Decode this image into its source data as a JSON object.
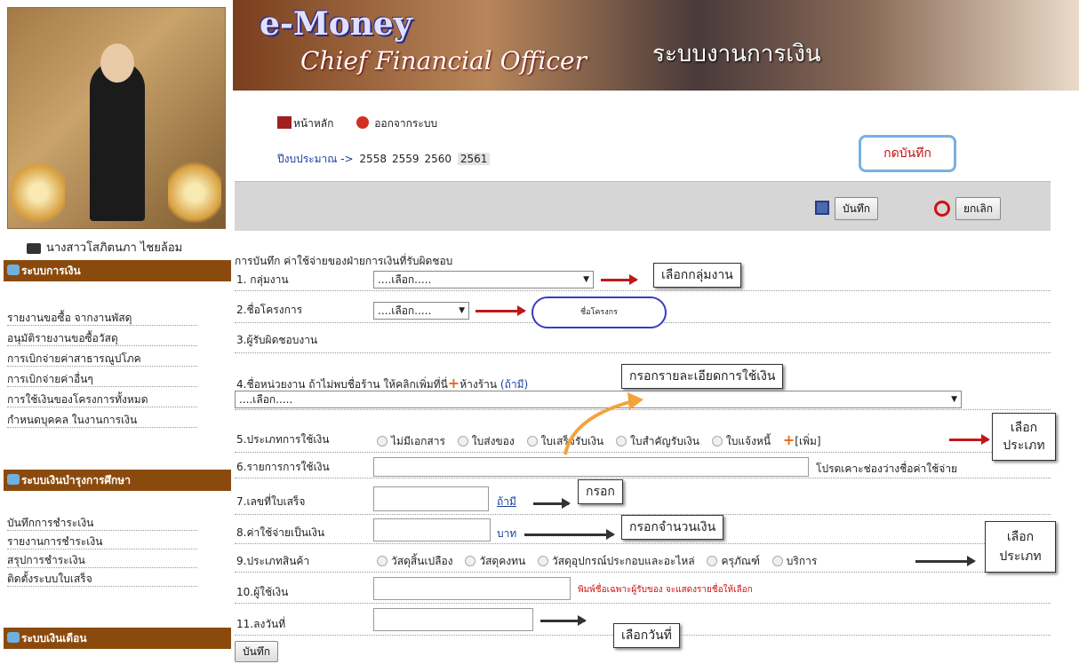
{
  "sidebar": {
    "user_name": "นางสาวโสภิตนภา ไชยล้อม",
    "sections": [
      {
        "title": "ระบบการเงิน",
        "items": [
          "รายงานขอซื้อ จากงานพัสดุ",
          "อนุมัติรายงานขอซื้อวัสดุ",
          "การเบิกจ่ายค่าสาธารณูปโภค",
          "การเบิกจ่ายค่าอื่นๆ",
          "การใช้เงินของโครงการทั้งหมด",
          "กำหนดบุคคล ในงานการเงิน"
        ]
      },
      {
        "title": "ระบบเงินบำรุงการศึกษา",
        "items": [
          "บันทึกการชำระเงิน",
          "รายงานการชำระเงิน",
          "สรุปการชำระเงิน",
          "ติดตั้งระบบใบเสร็จ"
        ]
      },
      {
        "title": "ระบบเงินเดือน",
        "items": []
      }
    ]
  },
  "banner": {
    "logo_line1": "e-Money",
    "logo_line2": "Chief Financial Officer",
    "title": "ระบบงานการเงิน"
  },
  "nav": {
    "home": "หน้าหลัก",
    "logout": "ออกจากระบบ"
  },
  "years": {
    "label": "ปีงบประมาณ ->",
    "list": [
      "2558",
      "2559",
      "2560"
    ],
    "current": "2561"
  },
  "toolbar": {
    "save": "บันทึก",
    "cancel": "ยกเลิก",
    "save_hint": "กดบันทึก"
  },
  "form": {
    "title": "การบันทึก ค่าใช้จ่ายของฝ่ายการเงินที่รับผิดชอบ",
    "select_placeholder": "....เลือก.....",
    "rows": {
      "group": "1. กลุ่มงาน",
      "project": "2.ชื่อโครงการ",
      "owner": "3.ผู้รับผิดชอบงาน",
      "vendor": "4.ชื่อหน่วยงาน ถ้าไม่พบชื่อร้าน ให้คลิกเพิ่มที่นี่",
      "vendor_link": "ห้างร้าน",
      "vendor_opt": "(ถ้ามี)",
      "paytype": "5.ประเภทการใช้เงิน",
      "desc": "6.รายการการใช้เงิน",
      "receipt": "7.เลขที่ใบเสร็จ",
      "amount": "8.ค่าใช้จ่ายเป็นเงิน",
      "goods": "9.ประเภทสินค้า",
      "payer": "10.ผู้ใช้เงิน",
      "date": "11.ลงวันที่"
    },
    "paytype_options": [
      "ไม่มีเอกสาร",
      "ใบส่งของ",
      "ใบเสร็จรับเงิน",
      "ใบสำคัญรับเงิน",
      "ใบแจ้งหนี้"
    ],
    "add_label": "[เพิ่ม]",
    "desc_note": "โปรดเคาะช่องว่างชื่อค่าใช้จ่าย",
    "receipt_opt": "ถ้ามี",
    "amount_unit": "บาท",
    "goods_options": [
      "วัสดุสิ้นเปลือง",
      "วัสดุคงทน",
      "วัสดุอุปกรณ์ประกอบและอะไหล่",
      "ครุภัณฑ์",
      "บริการ"
    ],
    "payer_note": "พิมพ์ชื่อเฉพาะผู้รับของ จะแสดงรายชื่อให้เลือก",
    "submit": "บันทึก"
  },
  "annotations": {
    "group": "เลือกกลุ่มงาน",
    "project": "ชื่อโครงกร",
    "detail": "กรอกรายละเอียดการใช้เงิน",
    "type1": "เลือกประเภท",
    "fill": "กรอก",
    "amount": "กรอกจำนวนเงิน",
    "type2": "เลือกประเภท",
    "date": "เลือกวันที่"
  }
}
